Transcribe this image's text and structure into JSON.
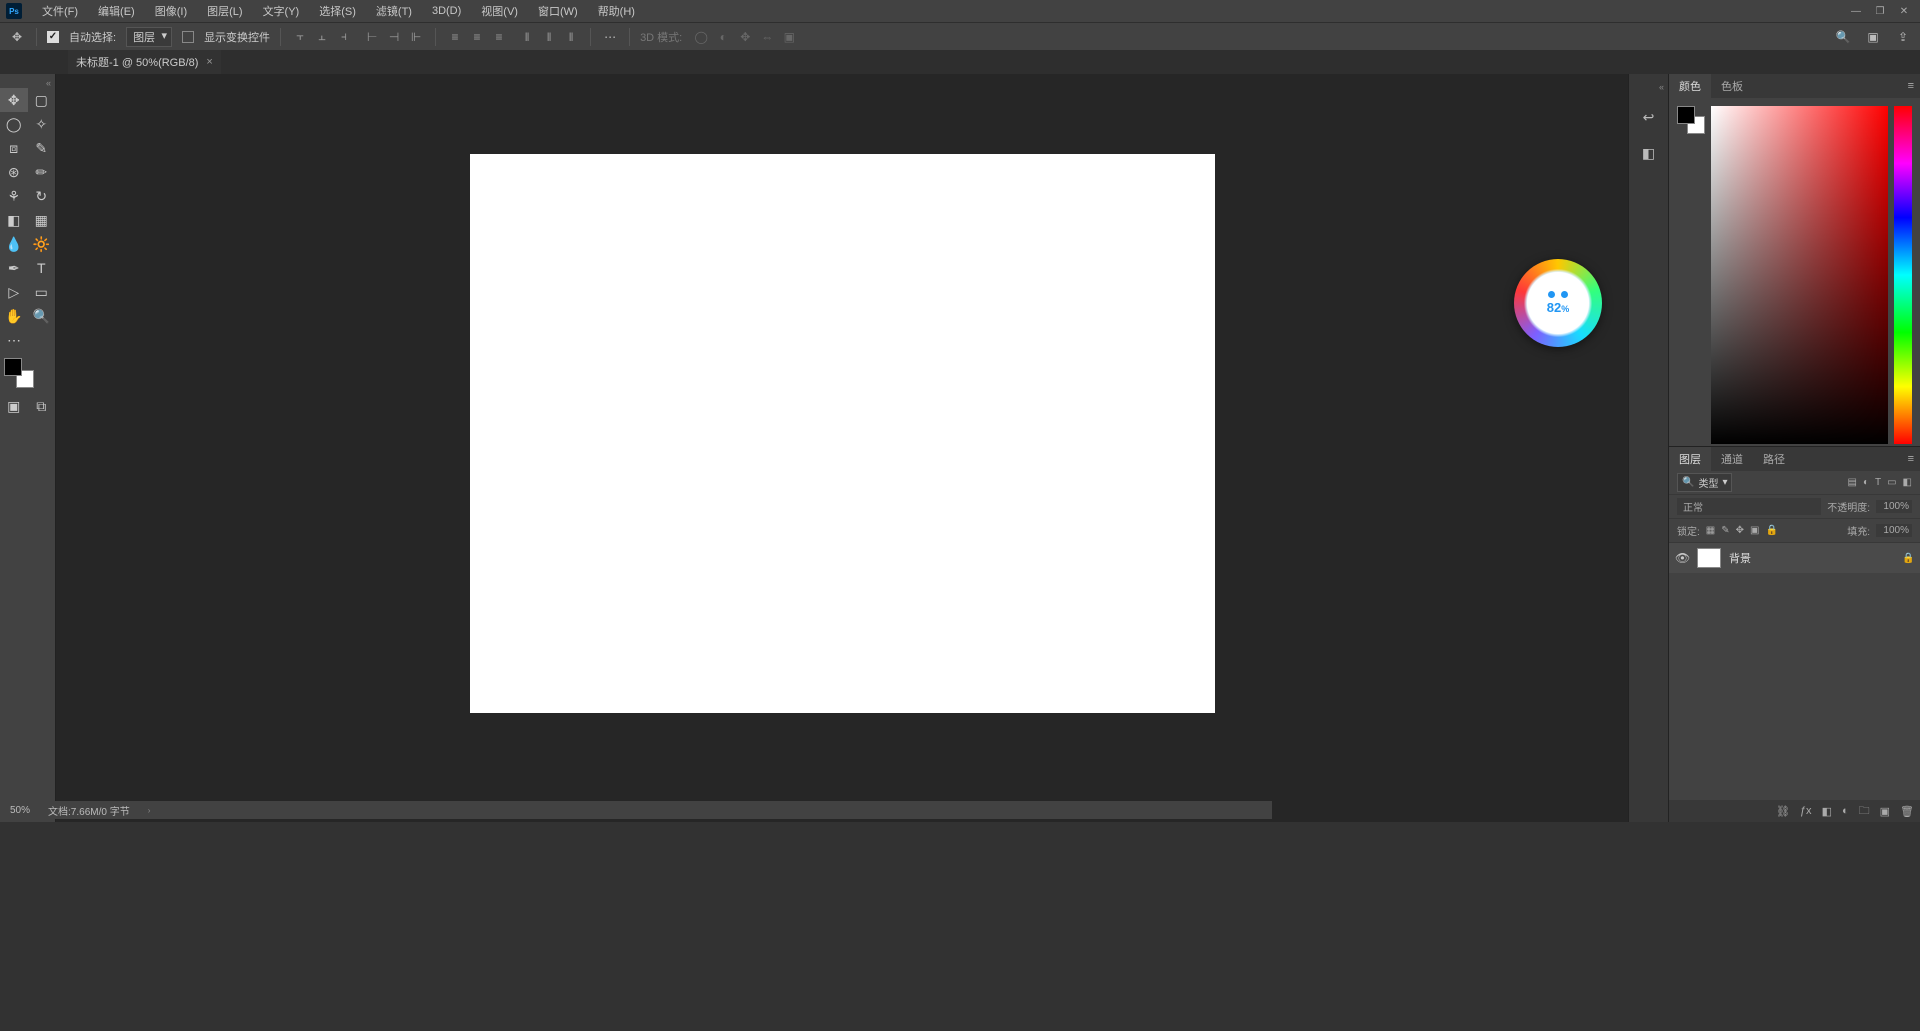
{
  "menu": {
    "items": [
      "文件(F)",
      "编辑(E)",
      "图像(I)",
      "图层(L)",
      "文字(Y)",
      "选择(S)",
      "滤镜(T)",
      "3D(D)",
      "视图(V)",
      "窗口(W)",
      "帮助(H)"
    ]
  },
  "options": {
    "auto_select": "自动选择:",
    "layer_dropdown": "图层",
    "show_transform": "显示变换控件",
    "mode3d": "3D 模式:"
  },
  "tab": {
    "title": "未标题-1 @ 50%(RGB/8)",
    "close": "×"
  },
  "float": {
    "pct_num": "82",
    "pct_sym": "%"
  },
  "color_panel": {
    "tabs": [
      "颜色",
      "色板"
    ]
  },
  "layers_panel": {
    "tabs": [
      "图层",
      "通道",
      "路径"
    ],
    "kind": "类型",
    "blend": "正常",
    "opacity_label": "不透明度:",
    "opacity_val": "100%",
    "lock_label": "锁定:",
    "fill_label": "填充:",
    "fill_val": "100%",
    "layer_name": "背景"
  },
  "status": {
    "zoom": "50%",
    "doc_info": "文档:7.66M/0 字节"
  }
}
